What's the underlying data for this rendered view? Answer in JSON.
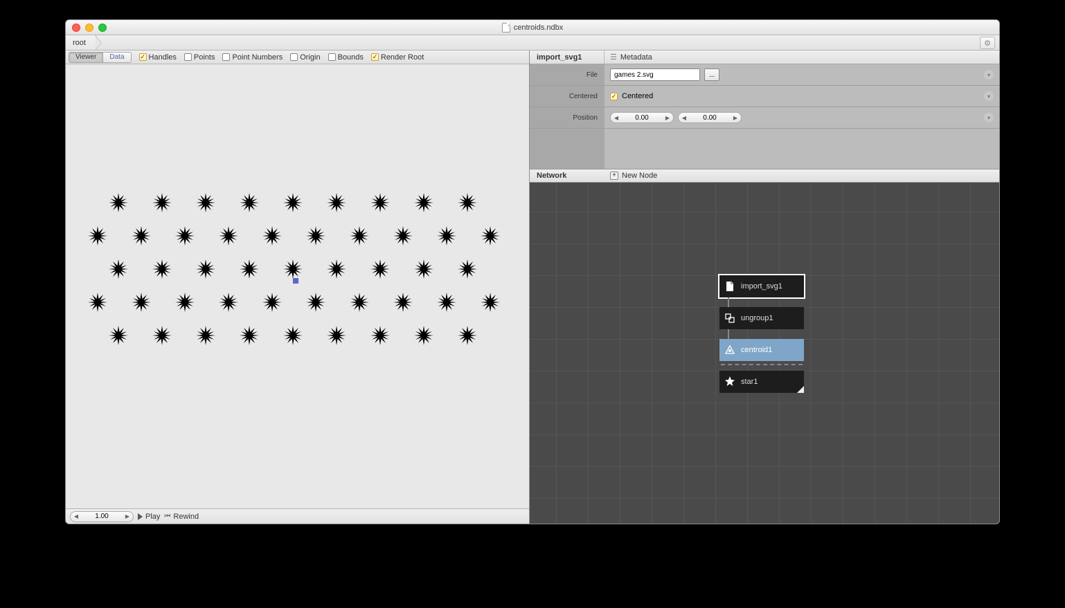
{
  "window": {
    "title": "centroids.ndbx"
  },
  "breadcrumb": {
    "root": "root"
  },
  "viewer": {
    "tabs": {
      "viewer": "Viewer",
      "data": "Data"
    },
    "checks": {
      "handles": "Handles",
      "points": "Points",
      "point_numbers": "Point Numbers",
      "origin": "Origin",
      "bounds": "Bounds",
      "render_root": "Render Root"
    }
  },
  "playbar": {
    "frame": "1.00",
    "play": "Play",
    "rewind": "Rewind"
  },
  "inspector": {
    "selected": "import_svg1",
    "metadata_label": "Metadata",
    "params": {
      "file_label": "File",
      "file_value": "games 2.svg",
      "file_browse": "...",
      "centered_label": "Centered",
      "centered_value": "Centered",
      "position_label": "Position",
      "position_x": "0.00",
      "position_y": "0.00"
    }
  },
  "network": {
    "label": "Network",
    "new_node": "New Node",
    "nodes": {
      "import_svg1": "import_svg1",
      "ungroup1": "ungroup1",
      "centroid1": "centroid1",
      "star1": "star1"
    }
  }
}
